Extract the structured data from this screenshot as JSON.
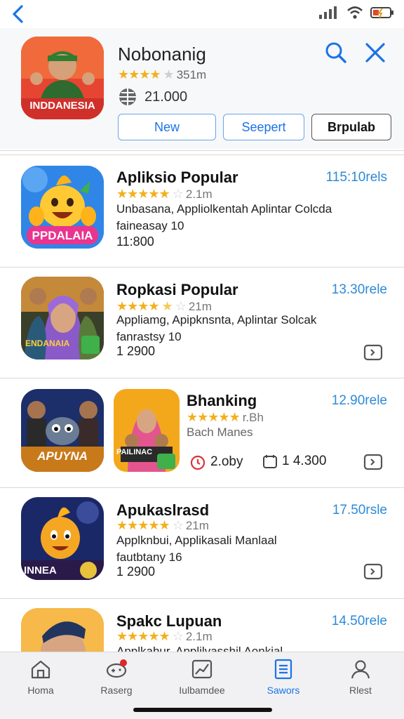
{
  "header": {
    "title": "Nobonanig",
    "rating_text": "351m",
    "downloads": "21.000",
    "icon_label": "INDDANESIA",
    "segments": [
      {
        "label": "New"
      },
      {
        "label": "Seepert"
      },
      {
        "label": "Brpulab"
      }
    ]
  },
  "apps": [
    {
      "name": "Apliksio Popular",
      "price": "115:10rels",
      "rating_text": "2.1m",
      "desc_line1": "Unbasana, Appliolkentah Aplintar Colcda",
      "desc_line2": "faineasay 10",
      "size": "11:800",
      "icon_label": "PPDALAIA"
    },
    {
      "name": "Ropkasi Popular",
      "price": "13.30rele",
      "rating_text": "21m",
      "desc_line1": "Appliamg, Apipknsnta, Aplintar Solcak",
      "desc_line2": "fanrastsy 10",
      "size": "1 2900",
      "icon_label": "ENDANAIA"
    },
    {
      "name": "Bhanking",
      "price": "12.90rele",
      "rating_text": "r.Bh",
      "subtitle": "Bach Manes",
      "stat1": "2.oby",
      "stat2": "1 4.300",
      "icon_label": "APUYNA",
      "icon2_label": "PAILINAC"
    },
    {
      "name": "Apukaslrasd",
      "price": "17.50rsle",
      "rating_text": "21m",
      "desc_line1": "Applknbui, Applikasali Manlaal",
      "desc_line2": "fautbtany 16",
      "size": "1 2900",
      "icon_label": "INNEA"
    },
    {
      "name": "Spakc Lupuan",
      "price": "14.50rele",
      "rating_text": "2.1m",
      "desc_line1": "Applkahur, Applilvasshil Aonkial"
    }
  ],
  "tabs": [
    {
      "label": "Homa",
      "icon": "home-icon"
    },
    {
      "label": "Raserg",
      "icon": "games-icon"
    },
    {
      "label": "Iulbamdee",
      "icon": "chart-icon"
    },
    {
      "label": "Sawors",
      "icon": "list-icon"
    },
    {
      "label": "Rlest",
      "icon": "person-icon"
    }
  ],
  "colors": {
    "accent": "#1a73e8",
    "price": "#2d8ad6",
    "star": "#f2b01e"
  }
}
